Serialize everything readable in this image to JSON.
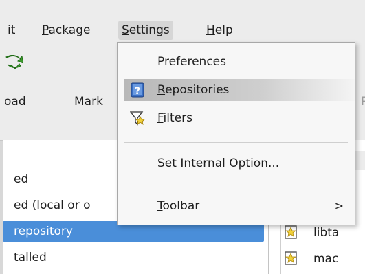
{
  "menubar": {
    "items": [
      {
        "label": "it",
        "mnemonic": ""
      },
      {
        "label": "Package",
        "mnemonic": "P",
        "rest": "ackage"
      },
      {
        "label": "Settings",
        "mnemonic": "S",
        "rest": "ettings"
      },
      {
        "label": "Help",
        "mnemonic": "H",
        "rest": "elp"
      }
    ]
  },
  "toolbar": {
    "reload_label": "oad",
    "mark_label": "Mark",
    "partial_label": "P"
  },
  "settings_menu": {
    "items": [
      {
        "label": "Preferences",
        "icon": "none"
      },
      {
        "mnemonic": "R",
        "rest": "epositories",
        "icon": "repositories-icon"
      },
      {
        "mnemonic": "F",
        "rest": "ilters",
        "icon": "filters-icon"
      },
      {
        "mnemonic": "S",
        "rest": "et Internal Option...",
        "icon": "none"
      },
      {
        "mnemonic": "T",
        "rest": "oolbar",
        "icon": "none",
        "submenu_arrow": ">"
      }
    ]
  },
  "left_pane": {
    "items": [
      {
        "label": "ed",
        "selected": false
      },
      {
        "label": "ed (local or o",
        "selected": false
      },
      {
        "label": " repository",
        "selected": true
      },
      {
        "label": "talled",
        "selected": false
      }
    ]
  },
  "right_pane": {
    "header": "c",
    "rows": [
      {
        "name": "r",
        "status": "none"
      },
      {
        "name": "g",
        "status": "none"
      },
      {
        "name": "libta",
        "status": "new-package-icon"
      },
      {
        "name": "mac",
        "status": "new-package-icon"
      }
    ]
  },
  "colors": {
    "selection": "#4a8ed9",
    "menu_highlight": "#b8b8b8",
    "background": "#ececec"
  }
}
